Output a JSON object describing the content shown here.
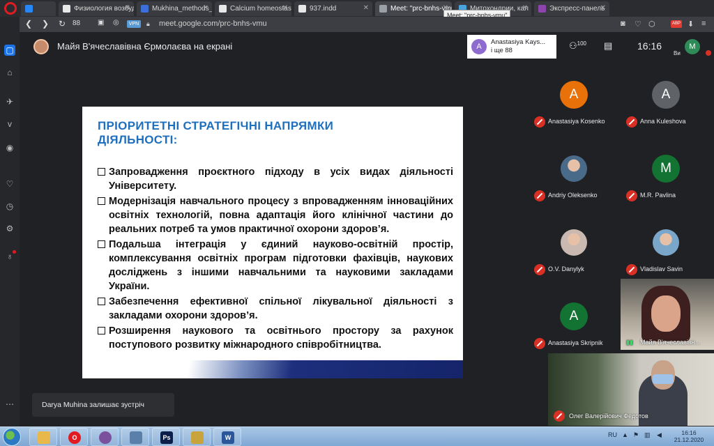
{
  "browser": {
    "tabs": [
      {
        "label": "",
        "icon": "vk-icon",
        "color": "#2787f5",
        "active": false
      },
      {
        "label": "Физиология возбуд",
        "icon": "doc-icon",
        "color": "#e8e8e8",
        "active": false
      },
      {
        "label": "Mukhina_methods_",
        "icon": "shield-icon",
        "color": "#3b6fd9",
        "active": false
      },
      {
        "label": "Calcium homeostas",
        "icon": "doc-icon",
        "color": "#e8e8e8",
        "active": false
      },
      {
        "label": "937.indd",
        "icon": "doc-icon",
        "color": "#e8e8e8",
        "active": false
      },
      {
        "label": "Meet: \"prc-bnhs-vmu",
        "icon": "speaker-icon",
        "color": "#9aa0a6",
        "active": true
      },
      {
        "label": "Митохондрии, кал",
        "icon": "doc-icon",
        "color": "#4aa3df",
        "active": false
      },
      {
        "label": "Экспресс-панель",
        "icon": "grid-icon",
        "color": "#8e44ad",
        "active": false
      }
    ],
    "tooltip": "Meet: \"prc-bnhs-vmu\"",
    "tab_count": "88",
    "vpn_label": "VPN",
    "url": "meet.google.com/prc-bnhs-vmu",
    "abp_label": "ABP"
  },
  "meet": {
    "presenter_title": "Майя В'ячеславівна Єрмолаєва на екрані",
    "notice": {
      "initial": "A",
      "name": "Anastasiya Kays...",
      "detail": "і ще 88"
    },
    "people_count": "100",
    "clock": "16:16",
    "you_label": "Ви",
    "me_initial": "M",
    "toast": "Darya Muhina залишає зустріч",
    "participants": [
      {
        "name": "Anastasiya Kosenko",
        "initial": "A",
        "color": "#e8710a",
        "photo": false
      },
      {
        "name": "Anna Kuleshova",
        "initial": "A",
        "color": "#5f6368",
        "photo": false
      },
      {
        "name": "Andriy Oleksenko",
        "initial": "",
        "color": "#4a6a8a",
        "photo": true
      },
      {
        "name": "M.R. Pavlina",
        "initial": "M",
        "color": "#137333",
        "photo": false
      },
      {
        "name": "O.V. Danylyk",
        "initial": "",
        "color": "#c9b9b1",
        "photo": true
      },
      {
        "name": "Vladislav Savin",
        "initial": "",
        "color": "#7aa7c9",
        "photo": true
      },
      {
        "name": "Anastasiya Skripnik",
        "initial": "A",
        "color": "#137333",
        "photo": false
      }
    ],
    "video_tiles": [
      {
        "name": "Майя В'ячеславівн..."
      },
      {
        "name": "Олег Валерійович Федотов"
      }
    ]
  },
  "slide": {
    "title": "ПРІОРИТЕТНІ СТРАТЕГІЧНІ НАПРЯМКИ ДІЯЛЬНОСТІ:",
    "bullets": [
      "Запровадження проєктного підходу в усіх видах діяльності Університету.",
      "Модернізація навчального процесу з впровадженням інноваційних освітніх технологій, повна адаптація його клінічної частини до реальних потреб та умов практичної охорони здоров’я.",
      "Подальша інтеграція у єдиний науково-освітній простір, комплексування освітніх програм підготовки фахівців, наукових досліджень з іншими навчальними та науковими закладами України.",
      "Забезпечення ефективної спільної лікувальної діяльності з закладами охорони здоров’я.",
      "Розширення наукового та освітнього простору за рахунок поступового розвитку міжнародного співробітництва."
    ]
  },
  "taskbar": {
    "apps": [
      {
        "icon": "folder-icon",
        "color": "#e8b84a",
        "label": ""
      },
      {
        "icon": "opera-icon",
        "color": "#e11b22",
        "label": "O"
      },
      {
        "icon": "viber-icon",
        "color": "#7b519d",
        "label": ""
      },
      {
        "icon": "network-icon",
        "color": "#5a7fa8",
        "label": ""
      },
      {
        "icon": "photoshop-icon",
        "color": "#0b1f4a",
        "label": "Ps"
      },
      {
        "icon": "paint-icon",
        "color": "#c9a33c",
        "label": ""
      },
      {
        "icon": "word-icon",
        "color": "#2b579a",
        "label": "W"
      }
    ],
    "lang": "RU",
    "time": "16:16",
    "date": "21.12.2020"
  }
}
